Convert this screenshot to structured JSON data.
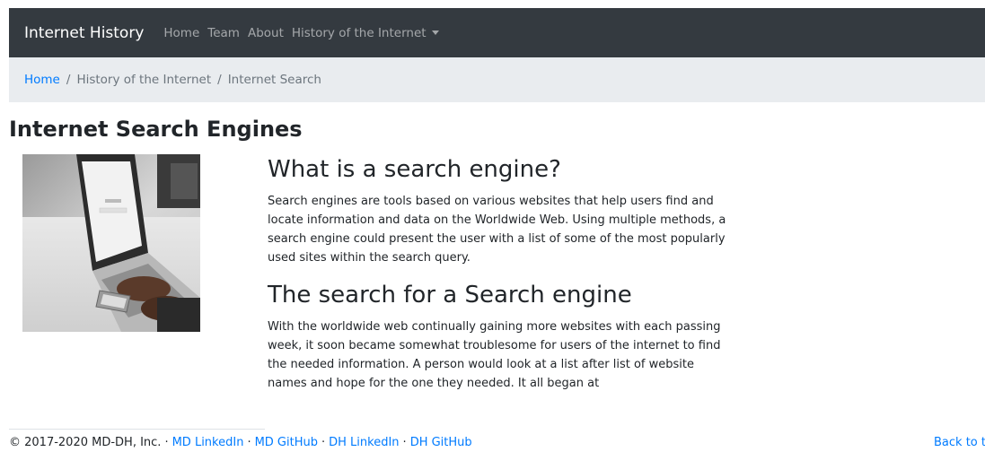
{
  "navbar": {
    "brand": "Internet History",
    "links": [
      "Home",
      "Team",
      "About",
      "History of the Internet"
    ]
  },
  "breadcrumb": {
    "home": "Home",
    "middle": "History of the Internet",
    "current": "Internet Search",
    "separator": "/"
  },
  "page": {
    "title": "Internet Search Engines"
  },
  "sections": [
    {
      "heading": "What is a search engine?",
      "text": "Search engines are tools based on various websites that help users find and locate information and data on the Worldwide Web. Using multiple methods, a search engine could present the user with a list of some of the most popularly used sites within the search query."
    },
    {
      "heading": "The search for a Search engine",
      "text": "With the worldwide web continually gaining more websites with each passing week, it soon became somewhat troublesome for users of the internet to find the needed information. A person would look at a list after list of website names and hope for the one they needed. It all began at"
    }
  ],
  "footer": {
    "copyright": "© 2017-2020 MD-DH, Inc.",
    "links": [
      "MD LinkedIn",
      "MD GitHub",
      "DH LinkedIn",
      "DH GitHub"
    ],
    "separator": "·",
    "back_to_top": "Back to to"
  },
  "colors": {
    "navbar_bg": "#343a40",
    "breadcrumb_bg": "#e9ecef",
    "link": "#007bff"
  }
}
